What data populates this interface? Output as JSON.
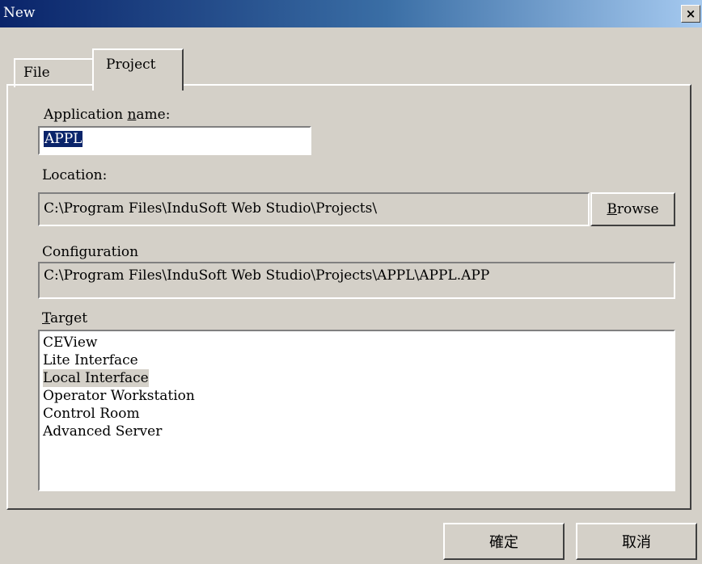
{
  "window": {
    "title": "New",
    "close_glyph": "×"
  },
  "tabs": [
    {
      "label": "File",
      "active": false
    },
    {
      "label": "Project",
      "active": true
    }
  ],
  "form": {
    "app_name": {
      "label_pre": "Application ",
      "label_accel": "n",
      "label_post": "ame:",
      "value": "APPL"
    },
    "location": {
      "label": "Location:",
      "value": "C:\\Program Files\\InduSoft Web Studio\\Projects\\"
    },
    "browse_button": {
      "label_accel": "B",
      "label_post": "rowse"
    },
    "configuration": {
      "label": "Configuration",
      "value": "C:\\Program Files\\InduSoft Web Studio\\Projects\\APPL\\APPL.APP"
    },
    "target": {
      "label_accel": "T",
      "label_post": "arget",
      "items": [
        "CEView",
        "Lite Interface",
        "Local Interface",
        "Operator Workstation",
        "Control Room",
        "Advanced Server"
      ],
      "highlighted": "Local Interface"
    }
  },
  "buttons": {
    "ok": "確定",
    "cancel": "取消"
  },
  "colors": {
    "title_start": "#0a246a",
    "title_end": "#a6caf0",
    "face": "#d4d0c8",
    "selection": "#0a246a"
  }
}
